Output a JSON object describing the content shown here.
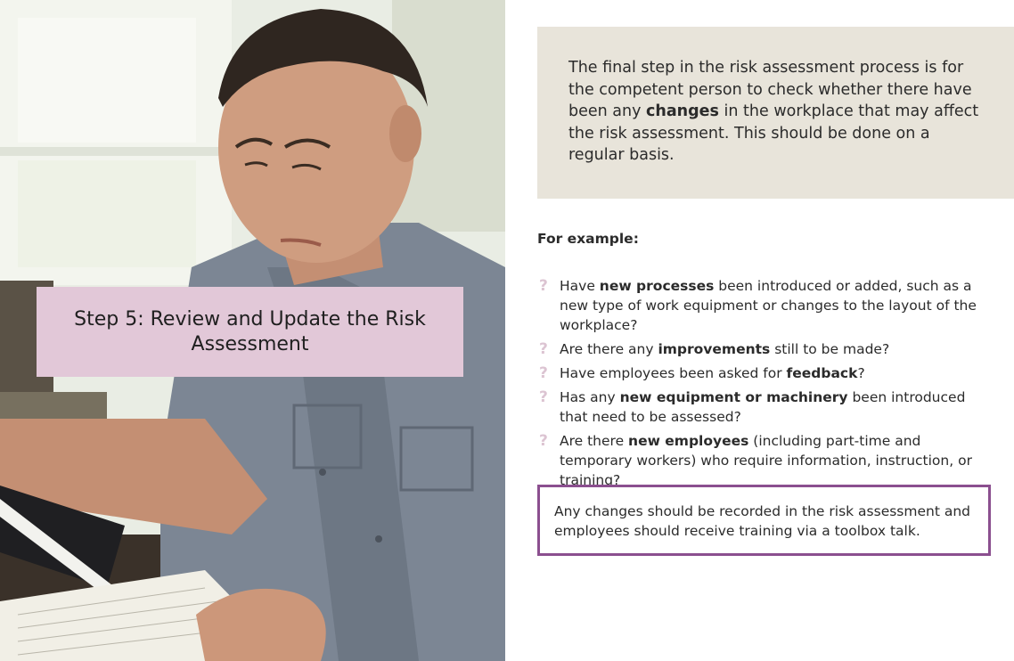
{
  "banner": {
    "title": "Step 5: Review and Update the Risk Assessment"
  },
  "intro": {
    "part1": "The final step in the risk assessment process is for the competent person to check whether there have been any ",
    "bold": "changes",
    "part2": " in the workplace that may affect the risk assessment. This should be done on a regular basis."
  },
  "example_label": "For example:",
  "questions": [
    {
      "icon": "question-mark-icon",
      "pre": "Have ",
      "bold": "new processes",
      "post": " been introduced or added, such as a new type of work equipment or changes to the layout of the workplace?"
    },
    {
      "icon": "question-mark-icon",
      "pre": "Are there any ",
      "bold": "improvements",
      "post": " still to be made?"
    },
    {
      "icon": "question-mark-icon",
      "pre": "Have employees been asked for ",
      "bold": "feedback",
      "post": "?"
    },
    {
      "icon": "question-mark-icon",
      "pre": "Has any ",
      "bold": "new equipment or machinery",
      "post": " been introduced that need to be assessed?"
    },
    {
      "icon": "question-mark-icon",
      "pre": "Are there ",
      "bold": "new employees",
      "post": " (including part-time and temporary workers) who require information, instruction, or training?"
    }
  ],
  "note": "Any changes should be recorded in the risk assessment and employees should receive training via a toolbox talk.",
  "colors": {
    "banner_bg": "#e2c8d8",
    "intro_bg": "#e8e4da",
    "note_border": "#8b4f8f",
    "qmark": "#dcc4d2"
  },
  "photo": {
    "subject": "man-reviewing-documents-at-desk-image"
  }
}
